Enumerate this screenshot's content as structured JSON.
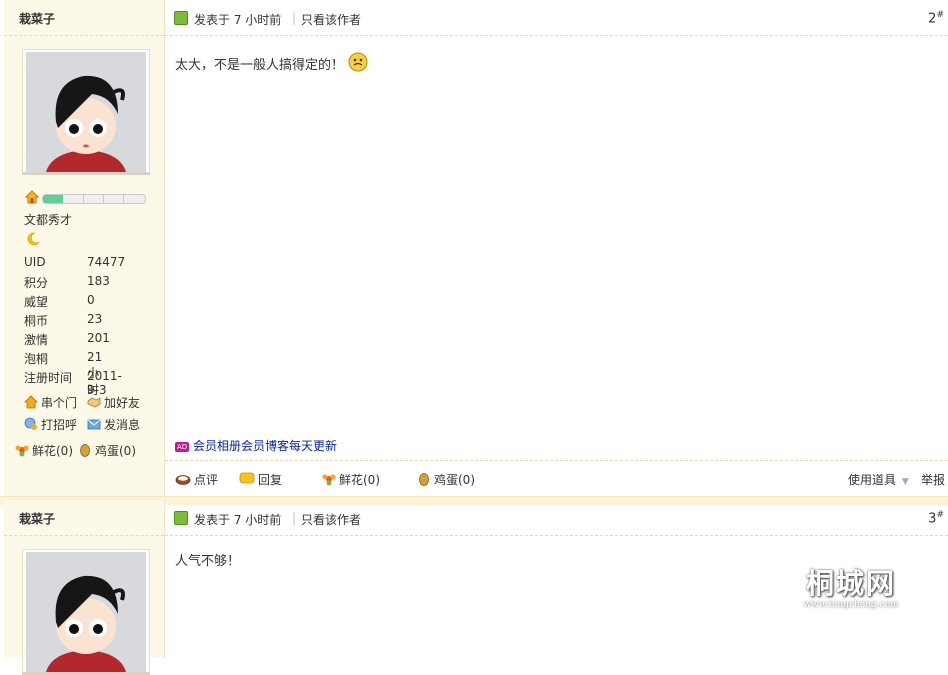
{
  "posts": [
    {
      "username": "栽菜子",
      "posted_time": "发表于 7 小时前",
      "sep": "|",
      "only_author": "只看该作者",
      "floor": "2",
      "floor_mark": "#",
      "content": "太大，不是一般人搞得定的！",
      "rank_title": "文都秀才",
      "stats": [
        {
          "k": "UID",
          "v": "74477"
        },
        {
          "k": "积分",
          "v": "183"
        },
        {
          "k": "威望",
          "v": "0"
        },
        {
          "k": "桐币",
          "v": "23"
        },
        {
          "k": "激情",
          "v": "201"
        },
        {
          "k": "泡桐",
          "v": "21 小时"
        },
        {
          "k": "注册时间",
          "v": "2011-9-3"
        }
      ],
      "actions": {
        "visit": "串个门",
        "add_friend": "加好友",
        "greet": "打招呼",
        "message": "发消息",
        "flower": "鲜花(0)",
        "egg": "鸡蛋(0)"
      },
      "ad_badge": "AD",
      "ad_text": "会员相册会员博客每天更新",
      "footer": {
        "comment": "点评",
        "reply": "回复",
        "flower": "鲜花(0)",
        "egg": "鸡蛋(0)",
        "use_tool": "使用道具",
        "report": "举报"
      }
    },
    {
      "username": "栽菜子",
      "posted_time": "发表于 7 小时前",
      "sep": "|",
      "only_author": "只看该作者",
      "floor": "3",
      "floor_mark": "#",
      "content": "人气不够！"
    }
  ],
  "watermark": {
    "title": "桐城网",
    "url": "www.tongcheng.com"
  },
  "colors": {
    "sidebar_bg": "#fdf9e8",
    "link_blue": "#0a2896",
    "progress_green": "#5fcf94"
  }
}
